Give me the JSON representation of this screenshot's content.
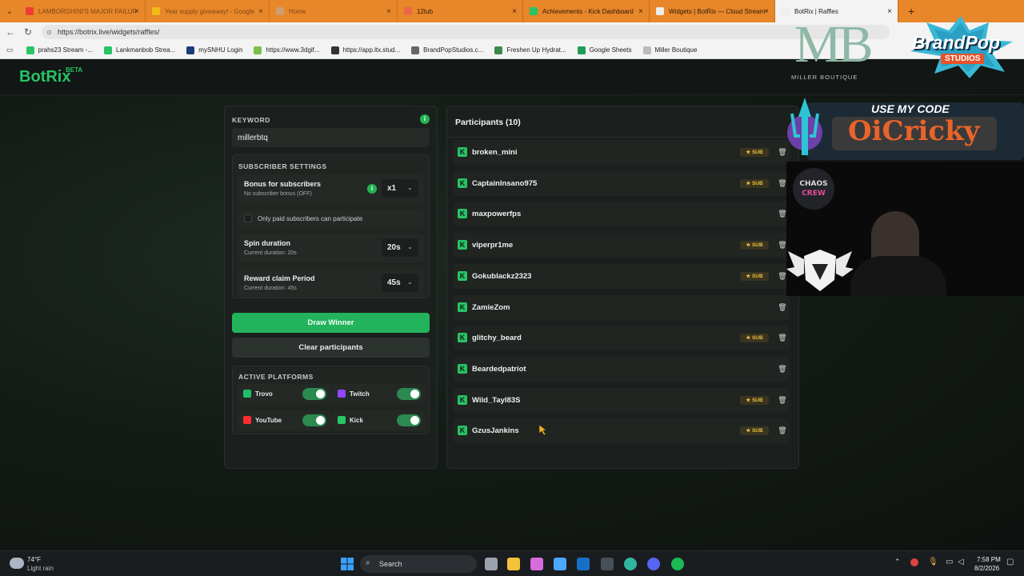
{
  "browser": {
    "tabs": [
      {
        "title": "LAMBORGHINI'S MAJOR FAILUR",
        "color": "#e33",
        "faded": true
      },
      {
        "title": "Year supply giveaway! - Google",
        "color": "#f5c518",
        "faded": true
      },
      {
        "title": "Home",
        "color": "#c9a27a",
        "faded": true
      },
      {
        "title": "12tub",
        "color": "#e64",
        "faded": false
      },
      {
        "title": "Achievements - Kick Dashboard",
        "color": "#28c466",
        "faded": false
      },
      {
        "title": "Widgets | BotRix — Cloud Stream",
        "color": "#eee",
        "faded": false
      },
      {
        "title": "BotRix | Raffles",
        "color": "#eee",
        "faded": false,
        "active": true
      }
    ],
    "url": "https://botrix.live/widgets/raffles/",
    "bookmarks": [
      {
        "label": "prahs23 Stream -...",
        "color": "#28c466"
      },
      {
        "label": "Lankmanbob Strea...",
        "color": "#28c466"
      },
      {
        "label": "mySNHU Login",
        "color": "#1b3d7a"
      },
      {
        "label": "https://www.3dgif...",
        "color": "#7bbf4a"
      },
      {
        "label": "https://app.ltx.stud...",
        "color": "#333"
      },
      {
        "label": "BrandPopStudios.c...",
        "color": "#666"
      },
      {
        "label": "Freshen Up Hydrat...",
        "color": "#3a8a4a"
      },
      {
        "label": "Google Sheets",
        "color": "#1f9d55"
      },
      {
        "label": "Miller Boutique",
        "color": "#bbb"
      }
    ]
  },
  "app": {
    "logo": "BotRix",
    "beta": "BETA",
    "accent": "#28c466"
  },
  "settings": {
    "keyword_label": "KEYWORD",
    "keyword_value": "millerbtq",
    "subscriber_section": "SUBSCRIBER SETTINGS",
    "bonus_title": "Bonus for subscribers",
    "bonus_sub": "No subscriber bonus (OFF)",
    "bonus_value": "x1",
    "only_paid": "Only paid subscribers can participate",
    "spin_title": "Spin duration",
    "spin_sub": "Current duration: 20s",
    "spin_value": "20s",
    "claim_title": "Reward claim Period",
    "claim_sub": "Current duration: 45s",
    "claim_value": "45s",
    "draw_button": "Draw Winner",
    "clear_button": "Clear participants",
    "platforms_label": "ACTIVE PLATFORMS",
    "platforms": [
      {
        "name": "Trovo",
        "color": "#1fbf6b",
        "enabled": true
      },
      {
        "name": "Twitch",
        "color": "#9146ff",
        "enabled": true
      },
      {
        "name": "YouTube",
        "color": "#ff2d2d",
        "enabled": true
      },
      {
        "name": "Kick",
        "color": "#28c466",
        "enabled": true
      }
    ]
  },
  "participants": {
    "header": "Participants (10)",
    "sub_label": "SUB",
    "list": [
      {
        "name": "broken_mini",
        "sub": true
      },
      {
        "name": "CaptainInsano975",
        "sub": true
      },
      {
        "name": "maxpowerfps",
        "sub": false
      },
      {
        "name": "viperpr1me",
        "sub": true
      },
      {
        "name": "Gokublackz2323",
        "sub": true
      },
      {
        "name": "ZamieZom",
        "sub": false
      },
      {
        "name": "glitchy_beard",
        "sub": true
      },
      {
        "name": "Beardedpatriot",
        "sub": false
      },
      {
        "name": "Wild_Tayl83S",
        "sub": true
      },
      {
        "name": "GzusJankins",
        "sub": true
      }
    ]
  },
  "overlay": {
    "mb_logo": "MB",
    "mb_text": "MILLER BOUTIQUE",
    "brandpop": "BrandPop",
    "studios": "STUDIOS",
    "use_code": "USE MY CODE",
    "code": "OiCricky",
    "chaos_crew": "CHAOS CREW"
  },
  "taskbar": {
    "temp": "74°F",
    "weather": "Light rain",
    "search": "Search",
    "time": "7:58 PM",
    "date": "8/2/2026"
  }
}
